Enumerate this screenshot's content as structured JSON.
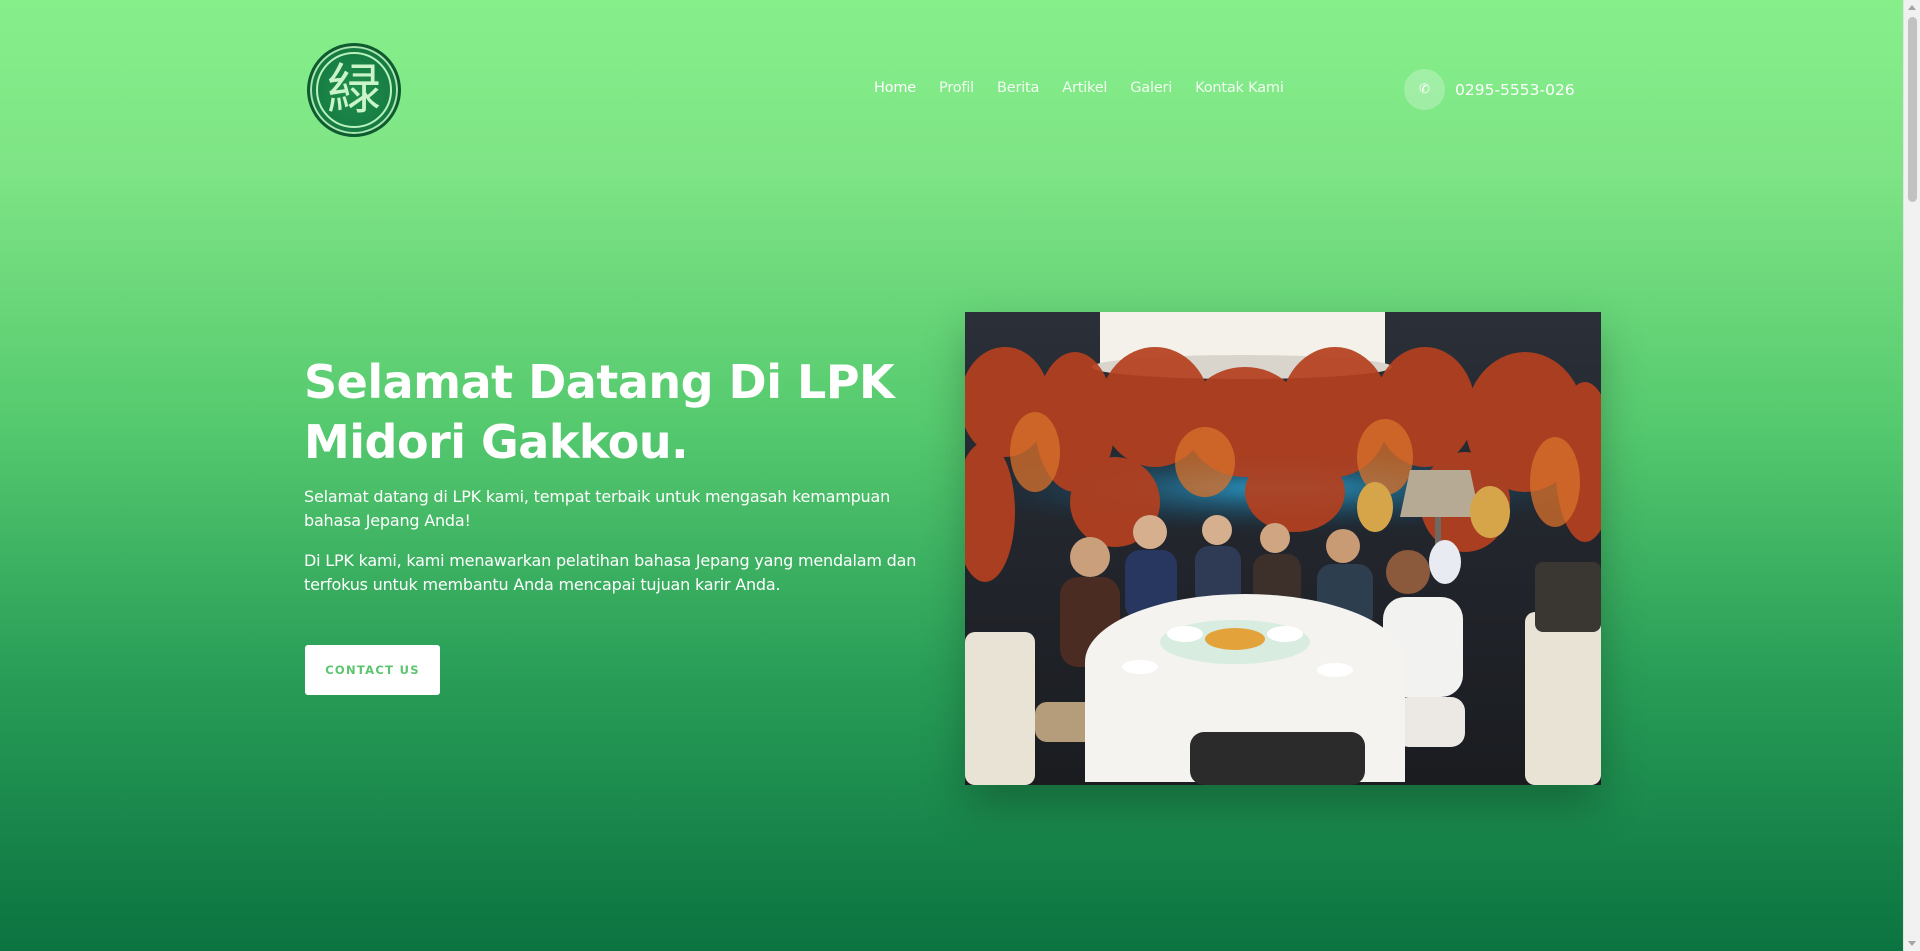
{
  "brand": {
    "logo_kanji": "緑",
    "logo_icon": "midori-gakkou-logo"
  },
  "nav": {
    "items": [
      {
        "label": "Home",
        "active": true
      },
      {
        "label": "Profil",
        "active": false
      },
      {
        "label": "Berita",
        "active": false
      },
      {
        "label": "Artikel",
        "active": false
      },
      {
        "label": "Galeri",
        "active": false
      },
      {
        "label": "Kontak Kami",
        "active": false
      }
    ]
  },
  "contact": {
    "icon": "phone-icon",
    "phone": "0295-5553-026"
  },
  "hero": {
    "title": "Selamat Datang Di LPK Midori Gakkou.",
    "paragraph_1": "Selamat datang di LPK kami, tempat terbaik untuk mengasah kemampuan bahasa Jepang Anda!",
    "paragraph_2": "Di LPK kami, kami menawarkan pelatihan bahasa Jepang yang mendalam dan terfokus untuk membantu Anda mencapai tujuan karir Anda.",
    "cta_label": "CONTACT US"
  },
  "colors": {
    "gradient_top": "#86ef8a",
    "gradient_bottom": "#0b7340",
    "cta_text": "#5cc46f"
  }
}
